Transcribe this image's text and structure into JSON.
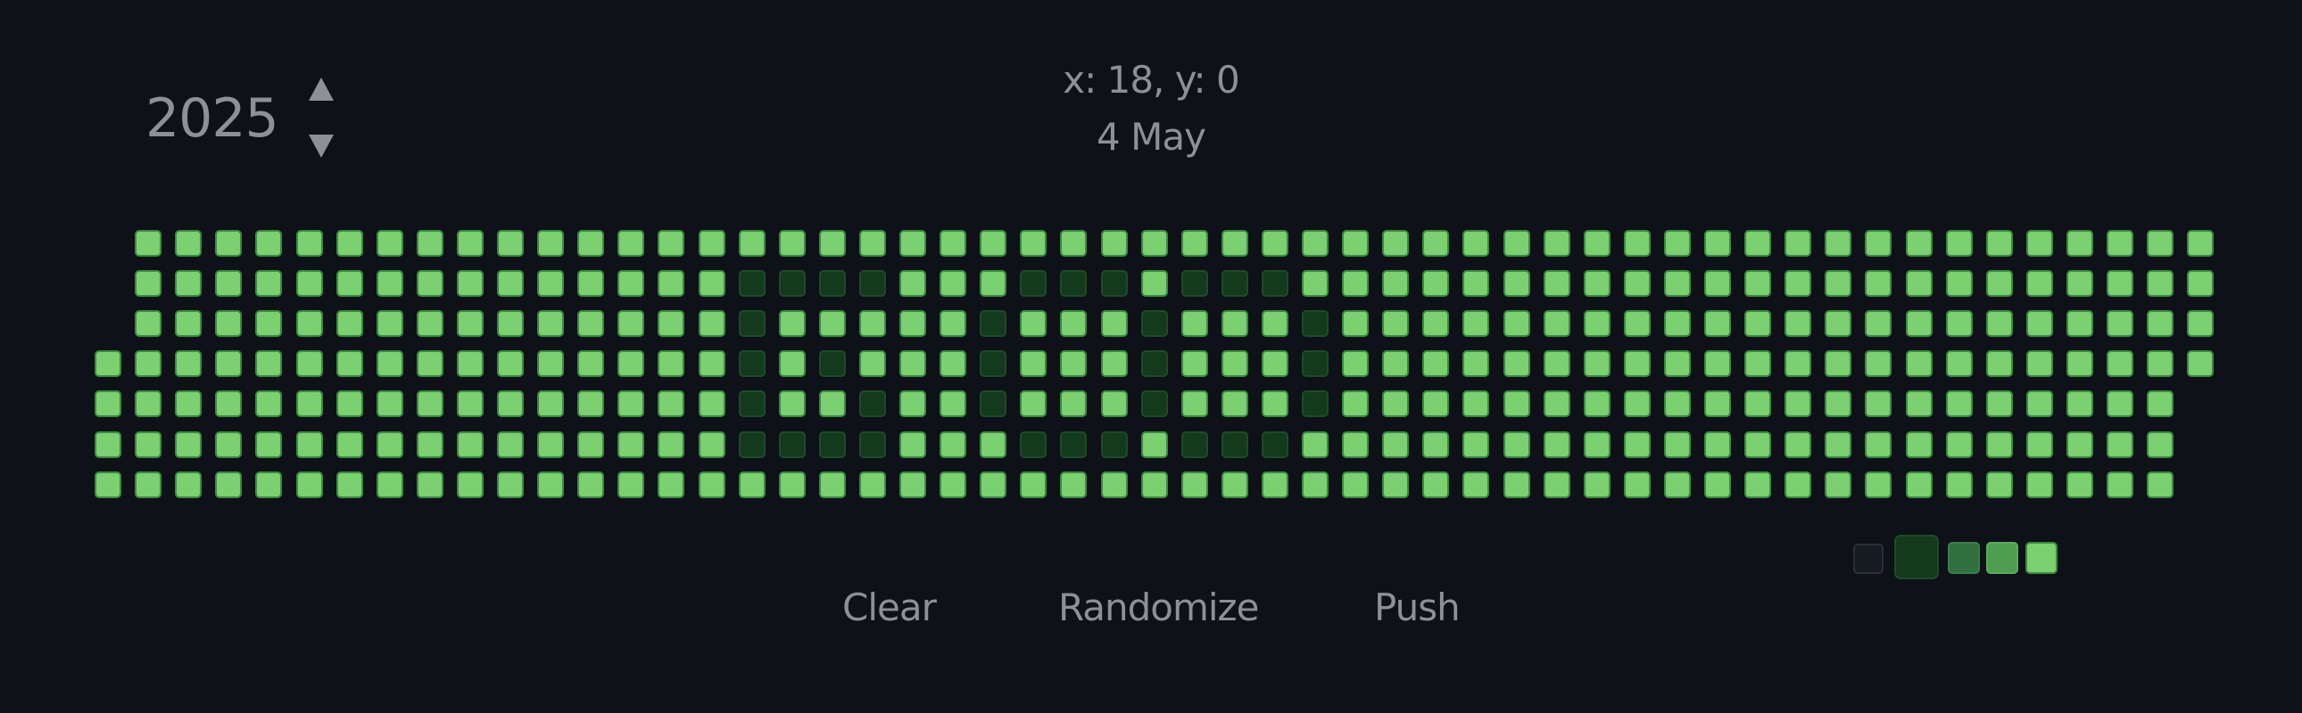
{
  "header": {
    "year": "2025",
    "coordinates": "x: 18, y: 0",
    "date": "4 May"
  },
  "year_picker": {
    "increment_icon": "triangle-up-icon",
    "decrement_icon": "triangle-down-icon"
  },
  "actions": {
    "clear_label": "Clear",
    "randomize_label": "Randomize",
    "push_label": "Push"
  },
  "palette": [
    {
      "level": 0,
      "fill": "#161b22",
      "border": "#2a2f38"
    },
    {
      "level": 1,
      "fill": "#133a1c",
      "border": "#1e4a29"
    },
    {
      "level": 2,
      "fill": "#30703f",
      "border": "#3c7d4a"
    },
    {
      "level": 3,
      "fill": "#4e9e50",
      "border": "#5aac5c"
    },
    {
      "level": 4,
      "fill": "#7bd06f",
      "border": "#3a8a42"
    }
  ],
  "legend": {
    "selected_level": 1,
    "levels": [
      0,
      1,
      2,
      3,
      4
    ]
  },
  "contribution_grid": {
    "week_count": 53,
    "first_week_start_day": 3,
    "last_week_day_count": 4,
    "default_level": 4,
    "weeks": [
      [
        4,
        4,
        4,
        4,
        4,
        4,
        4
      ],
      [
        4,
        4,
        4,
        4,
        4,
        4,
        4
      ],
      [
        4,
        4,
        4,
        4,
        4,
        4,
        4
      ],
      [
        4,
        4,
        4,
        4,
        4,
        4,
        4
      ],
      [
        4,
        4,
        4,
        4,
        4,
        4,
        4
      ],
      [
        4,
        4,
        4,
        4,
        4,
        4,
        4
      ],
      [
        4,
        4,
        4,
        4,
        4,
        4,
        4
      ],
      [
        4,
        4,
        4,
        4,
        4,
        4,
        4
      ],
      [
        4,
        4,
        4,
        4,
        4,
        4,
        4
      ],
      [
        4,
        4,
        4,
        4,
        4,
        4,
        4
      ],
      [
        4,
        4,
        4,
        4,
        4,
        4,
        4
      ],
      [
        4,
        4,
        4,
        4,
        4,
        4,
        4
      ],
      [
        4,
        4,
        4,
        4,
        4,
        4,
        4
      ],
      [
        4,
        4,
        4,
        4,
        4,
        4,
        4
      ],
      [
        4,
        4,
        4,
        4,
        4,
        4,
        4
      ],
      [
        4,
        4,
        4,
        4,
        4,
        4,
        4
      ],
      [
        4,
        1,
        1,
        1,
        1,
        1,
        4
      ],
      [
        4,
        1,
        4,
        4,
        4,
        1,
        4
      ],
      [
        4,
        1,
        4,
        1,
        4,
        1,
        4
      ],
      [
        4,
        1,
        4,
        4,
        1,
        1,
        4
      ],
      [
        4,
        4,
        4,
        4,
        4,
        4,
        4
      ],
      [
        4,
        4,
        4,
        4,
        4,
        4,
        4
      ],
      [
        4,
        4,
        1,
        1,
        1,
        4,
        4
      ],
      [
        4,
        1,
        4,
        4,
        4,
        1,
        4
      ],
      [
        4,
        1,
        4,
        4,
        4,
        1,
        4
      ],
      [
        4,
        1,
        4,
        4,
        4,
        1,
        4
      ],
      [
        4,
        4,
        1,
        1,
        1,
        4,
        4
      ],
      [
        4,
        1,
        4,
        4,
        4,
        1,
        4
      ],
      [
        4,
        1,
        4,
        4,
        4,
        1,
        4
      ],
      [
        4,
        1,
        4,
        4,
        4,
        1,
        4
      ],
      [
        4,
        4,
        1,
        1,
        1,
        4,
        4
      ],
      [
        4,
        4,
        4,
        4,
        4,
        4,
        4
      ],
      [
        4,
        4,
        4,
        4,
        4,
        4,
        4
      ],
      [
        4,
        4,
        4,
        4,
        4,
        4,
        4
      ],
      [
        4,
        4,
        4,
        4,
        4,
        4,
        4
      ],
      [
        4,
        4,
        4,
        4,
        4,
        4,
        4
      ],
      [
        4,
        4,
        4,
        4,
        4,
        4,
        4
      ],
      [
        4,
        4,
        4,
        4,
        4,
        4,
        4
      ],
      [
        4,
        4,
        4,
        4,
        4,
        4,
        4
      ],
      [
        4,
        4,
        4,
        4,
        4,
        4,
        4
      ],
      [
        4,
        4,
        4,
        4,
        4,
        4,
        4
      ],
      [
        4,
        4,
        4,
        4,
        4,
        4,
        4
      ],
      [
        4,
        4,
        4,
        4,
        4,
        4,
        4
      ],
      [
        4,
        4,
        4,
        4,
        4,
        4,
        4
      ],
      [
        4,
        4,
        4,
        4,
        4,
        4,
        4
      ],
      [
        4,
        4,
        4,
        4,
        4,
        4,
        4
      ],
      [
        4,
        4,
        4,
        4,
        4,
        4,
        4
      ],
      [
        4,
        4,
        4,
        4,
        4,
        4,
        4
      ],
      [
        4,
        4,
        4,
        4,
        4,
        4,
        4
      ],
      [
        4,
        4,
        4,
        4,
        4,
        4,
        4
      ],
      [
        4,
        4,
        4,
        4,
        4,
        4,
        4
      ],
      [
        4,
        4,
        4,
        4,
        4,
        4,
        4
      ],
      [
        4,
        4,
        4,
        4,
        4,
        4,
        4
      ]
    ]
  }
}
